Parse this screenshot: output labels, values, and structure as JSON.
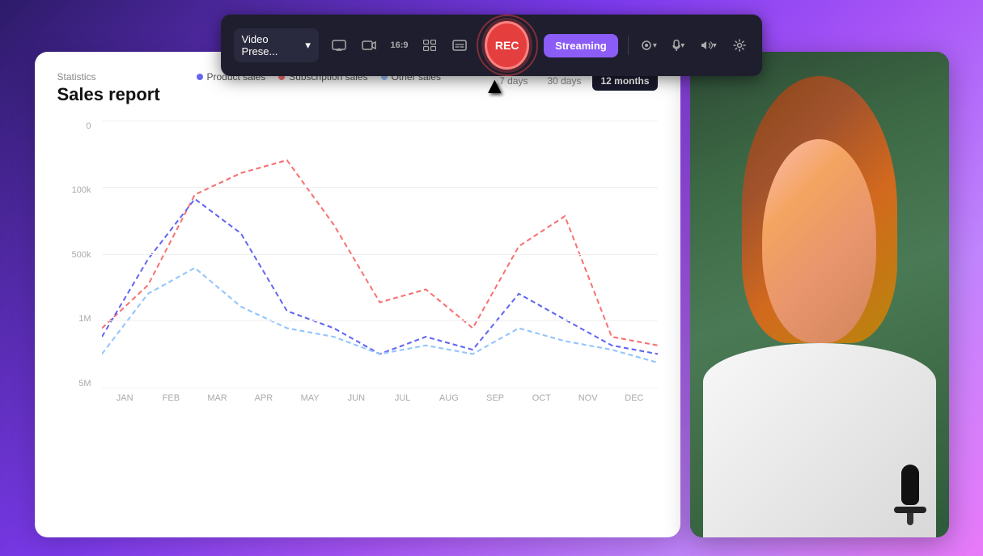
{
  "toolbar": {
    "dropdown_label": "Video Prese...",
    "rec_label": "REC",
    "streaming_label": "Streaming",
    "time_filters": [
      "7 days",
      "30 days",
      "12 months"
    ],
    "active_filter": "12 months"
  },
  "chart": {
    "title": "Sales report",
    "subtitle": "Statistics",
    "legend": [
      {
        "label": "Product sales",
        "color": "#6366f1"
      },
      {
        "label": "Subscription sales",
        "color": "#f87171"
      },
      {
        "label": "Other sales",
        "color": "#93c5fd"
      }
    ],
    "y_labels": [
      "0",
      "100k",
      "500k",
      "1M",
      "5M"
    ],
    "x_labels": [
      "JAN",
      "FEB",
      "MAR",
      "APR",
      "MAY",
      "JUN",
      "JUL",
      "AUG",
      "SEP",
      "OCT",
      "NOV",
      "DEC"
    ],
    "active_filter": "12 months"
  }
}
